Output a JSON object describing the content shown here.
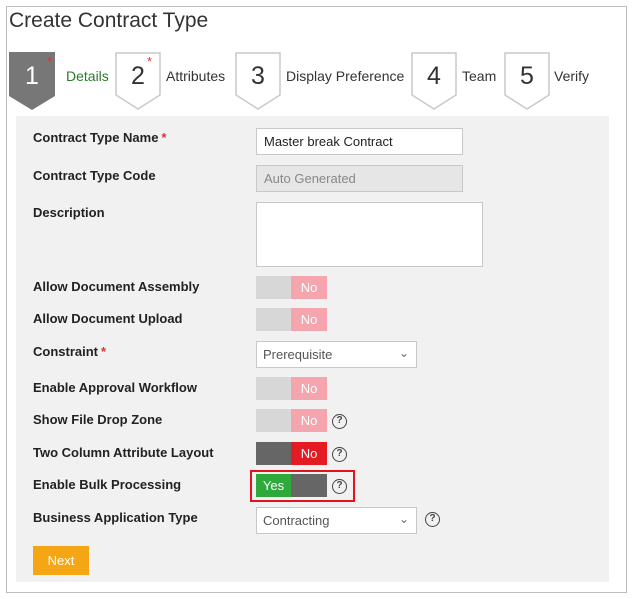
{
  "page": {
    "title": "Create Contract Type"
  },
  "steps": [
    {
      "number": "1",
      "label": "Details",
      "required": true,
      "active": true
    },
    {
      "number": "2",
      "label": "Attributes",
      "required": true,
      "active": false
    },
    {
      "number": "3",
      "label": "Display Preference",
      "required": false,
      "active": false
    },
    {
      "number": "4",
      "label": "Team",
      "required": false,
      "active": false
    },
    {
      "number": "5",
      "label": "Verify",
      "required": false,
      "active": false
    }
  ],
  "required_marker": "*",
  "form": {
    "contract_type_name": {
      "label": "Contract Type Name",
      "value": "Master break Contract",
      "required": true
    },
    "contract_type_code": {
      "label": "Contract Type Code",
      "placeholder": "Auto Generated"
    },
    "description": {
      "label": "Description",
      "value": ""
    },
    "allow_document_assembly": {
      "label": "Allow Document Assembly",
      "state": "No"
    },
    "allow_document_upload": {
      "label": "Allow Document Upload",
      "state": "No"
    },
    "constraint": {
      "label": "Constraint",
      "value": "Prerequisite",
      "required": true
    },
    "enable_approval_workflow": {
      "label": "Enable Approval Workflow",
      "state": "No"
    },
    "show_file_drop_zone": {
      "label": "Show File Drop Zone",
      "state": "No"
    },
    "two_column_attribute_layout": {
      "label": "Two Column Attribute Layout",
      "state": "No"
    },
    "enable_bulk_processing": {
      "label": "Enable Bulk Processing",
      "state": "Yes"
    },
    "business_application_type": {
      "label": "Business Application Type",
      "value": "Contracting"
    }
  },
  "help_glyph": "?",
  "chevron_glyph": "⌄",
  "next_label": "Next",
  "colors": {
    "accent_orange": "#f5a614",
    "toggle_no_light": "#f4a5ad",
    "toggle_no_dark": "#e41b23",
    "toggle_yes": "#2eaa3c",
    "active_step": "#777777",
    "highlight": "#e3131b"
  }
}
